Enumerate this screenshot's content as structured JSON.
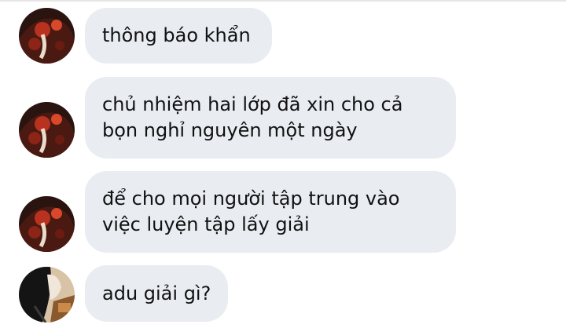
{
  "messages": [
    {
      "avatar": "avatar-red",
      "lines": [
        "thông báo khẩn"
      ]
    },
    {
      "avatar": "avatar-red",
      "lines": [
        "chủ nhiệm hai lớp đã xin cho cả",
        "bọn nghỉ nguyên một ngày"
      ]
    },
    {
      "avatar": "avatar-red",
      "lines": [
        "để cho mọi người tập trung vào",
        "việc luyện tập lấy giải"
      ]
    },
    {
      "avatar": "avatar-dark",
      "lines": [
        "adu giải gì?"
      ]
    }
  ],
  "colors": {
    "bubble": "#e9ecf1",
    "text": "#111111",
    "avatar_red_bg": "#2a1410",
    "avatar_red_accent": "#b8321f",
    "avatar_dark_bg": "#d9c3a6",
    "avatar_dark_accent": "#141414"
  }
}
